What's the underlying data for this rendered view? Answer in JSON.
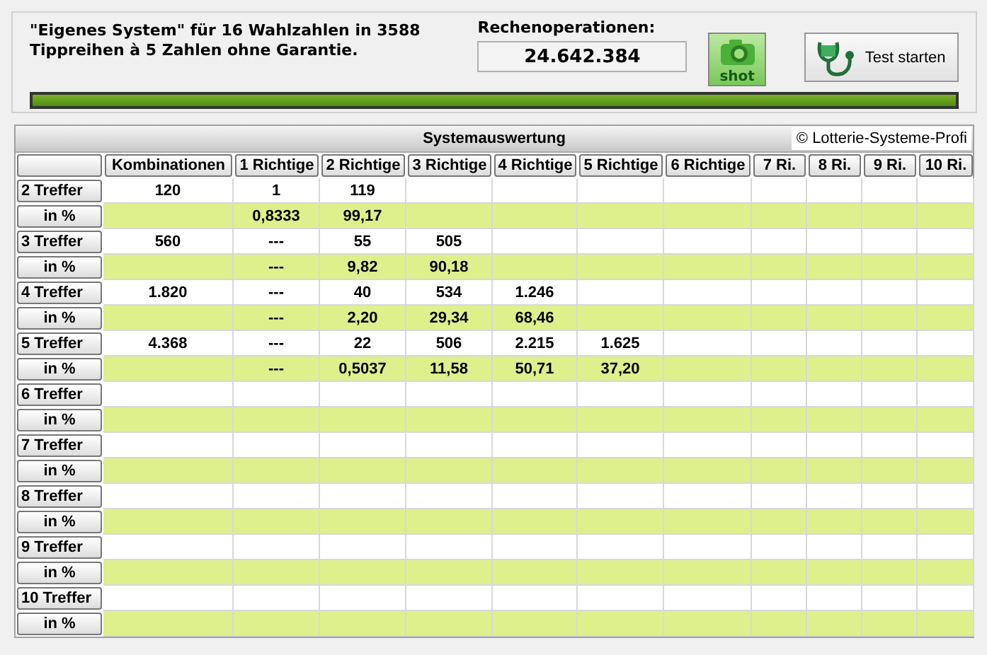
{
  "header": {
    "description": "\"Eigenes System\" für 16 Wahlzahlen in 3588 Tippreihen à 5 Zahlen ohne Garantie.",
    "operations_label": "Rechenoperationen:",
    "operations_value": "24.642.384",
    "shot_button": "shot",
    "test_button": "Test starten"
  },
  "progress": {
    "level": 1
  },
  "table": {
    "title": "Systemauswertung",
    "copyright": "© Lotterie-Systeme-Profi",
    "columns": [
      "Kombinationen",
      "1 Richtige",
      "2 Richtige",
      "3 Richtige",
      "4 Richtige",
      "5 Richtige",
      "6 Richtige",
      "7 Ri.",
      "8 Ri.",
      "9 Ri.",
      "10 Ri."
    ],
    "rows": [
      {
        "kind": "count",
        "label": "2 Treffer",
        "combinations": "120",
        "hits": [
          "1",
          "119"
        ]
      },
      {
        "kind": "percent",
        "label": "in %",
        "hits": [
          "0,8333",
          "99,17"
        ]
      },
      {
        "kind": "count",
        "label": "3 Treffer",
        "combinations": "560",
        "hits": [
          "---",
          "55",
          "505"
        ]
      },
      {
        "kind": "percent",
        "label": "in %",
        "hits": [
          "---",
          "9,82",
          "90,18"
        ]
      },
      {
        "kind": "count",
        "label": "4 Treffer",
        "combinations": "1.820",
        "hits": [
          "---",
          "40",
          "534",
          "1.246"
        ]
      },
      {
        "kind": "percent",
        "label": "in %",
        "hits": [
          "---",
          "2,20",
          "29,34",
          "68,46"
        ]
      },
      {
        "kind": "count",
        "label": "5 Treffer",
        "combinations": "4.368",
        "hits": [
          "---",
          "22",
          "506",
          "2.215",
          "1.625"
        ]
      },
      {
        "kind": "percent",
        "label": "in %",
        "hits": [
          "---",
          "0,5037",
          "11,58",
          "50,71",
          "37,20"
        ]
      },
      {
        "kind": "count",
        "label": "6 Treffer"
      },
      {
        "kind": "percent",
        "label": "in %"
      },
      {
        "kind": "count",
        "label": "7 Treffer"
      },
      {
        "kind": "percent",
        "label": "in %"
      },
      {
        "kind": "count",
        "label": "8 Treffer"
      },
      {
        "kind": "percent",
        "label": "in %"
      },
      {
        "kind": "count",
        "label": "9 Treffer"
      },
      {
        "kind": "percent",
        "label": "in %"
      },
      {
        "kind": "count",
        "label": "10 Treffer"
      },
      {
        "kind": "percent",
        "label": "in %"
      }
    ]
  }
}
